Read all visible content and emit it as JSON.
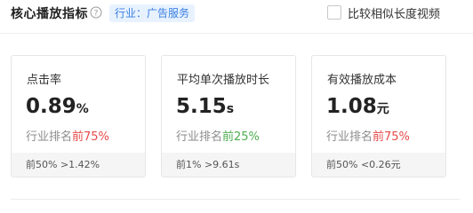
{
  "header": {
    "title": "核心播放指标",
    "industry_tag": "行业：广告服务",
    "compare_label": "比较相似长度视频"
  },
  "cards": [
    {
      "label": "点击率",
      "value": "0.89",
      "unit": "%",
      "rank_prefix": "行业排名",
      "rank_value": "前75%",
      "rank_color": "#e84a4a",
      "foot": "前50% >1.42%"
    },
    {
      "label": "平均单次播放时长",
      "value": "5.15",
      "unit": "s",
      "rank_prefix": "行业排名",
      "rank_value": "前25%",
      "rank_color": "#4cae4f",
      "foot": "前1% >9.61s"
    },
    {
      "label": "有效播放成本",
      "value": "1.08",
      "unit": "元",
      "rank_prefix": "行业排名",
      "rank_value": "前75%",
      "rank_color": "#e84a4a",
      "foot": "前50% <0.26元"
    }
  ]
}
